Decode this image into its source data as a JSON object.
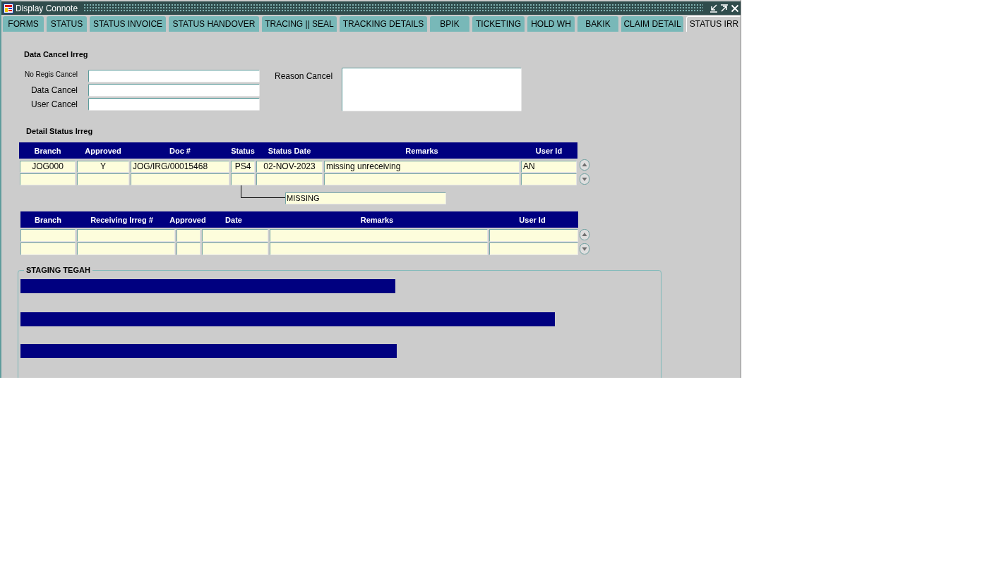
{
  "window": {
    "title": "Display Connote"
  },
  "tabs": [
    {
      "label": "FORMS",
      "selected": false
    },
    {
      "label": "STATUS",
      "selected": false
    },
    {
      "label": "STATUS INVOICE",
      "selected": false
    },
    {
      "label": "STATUS HANDOVER",
      "selected": false
    },
    {
      "label": "TRACING || SEAL",
      "selected": false
    },
    {
      "label": "TRACKING DETAILS",
      "selected": false
    },
    {
      "label": "BPIK",
      "selected": false
    },
    {
      "label": "TICKETING",
      "selected": false
    },
    {
      "label": "HOLD WH",
      "selected": false
    },
    {
      "label": "BAKIK",
      "selected": false
    },
    {
      "label": "CLAIM DETAIL",
      "selected": false
    },
    {
      "label": "STATUS IRR",
      "selected": true
    }
  ],
  "cancel_irreg": {
    "title": "Data Cancel Irreg",
    "fields": [
      {
        "label": "No Regis Cancel"
      },
      {
        "label": "Data Cancel"
      },
      {
        "label": "User Cancel"
      }
    ],
    "reason_label": "Reason Cancel"
  },
  "detail_status": {
    "title": "Detail Status Irreg",
    "columns": [
      "Branch",
      "Approved",
      "Doc #",
      "Status",
      "Status Date",
      "Remarks",
      "User Id"
    ],
    "rows": [
      [
        "JOG000",
        "Y",
        "JOG/IRG/00015468",
        "PS4",
        "02-NOV-2023",
        "missing unreceiving",
        "AN"
      ]
    ],
    "status_hint": "MISSING"
  },
  "receiving": {
    "columns": [
      "Branch",
      "Receiving Irreg #",
      "Approved",
      "Date",
      "Remarks",
      "User Id"
    ]
  },
  "staging": {
    "title": "STAGING TEGAH"
  }
}
